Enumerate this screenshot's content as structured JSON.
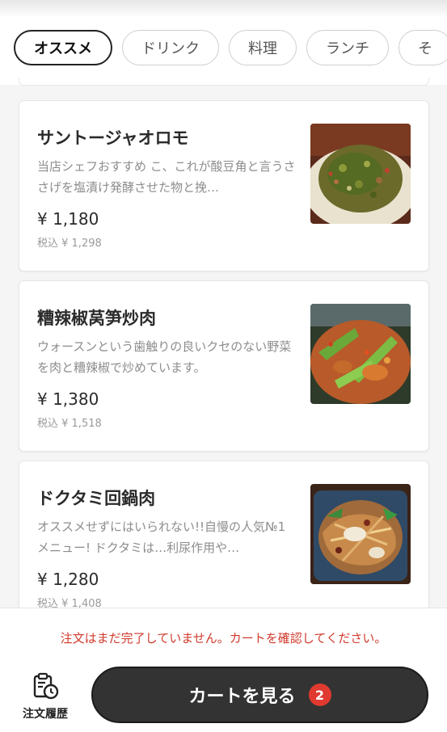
{
  "tabs": [
    {
      "label": "オススメ",
      "active": true
    },
    {
      "label": "ドリンク",
      "active": false
    },
    {
      "label": "料理",
      "active": false
    },
    {
      "label": "ランチ",
      "active": false
    },
    {
      "label": "そ",
      "active": false
    }
  ],
  "menu_items": [
    {
      "name": "サントージャオロモ",
      "description": "当店シェフおすすめ こ、これが酸豆角と言うささげを塩漬け発酵させた物と挽…",
      "price": "¥ 1,180",
      "tax_price": "税込 ¥ 1,298"
    },
    {
      "name": "糟辣椒莴笋炒肉",
      "description": "ウォースンという歯触りの良いクセのない野菜を肉と糟辣椒で炒めています。",
      "price": "¥ 1,380",
      "tax_price": "税込 ¥ 1,518"
    },
    {
      "name": "ドクタミ回鍋肉",
      "description": "オススメせずにはいられない!!自慢の人気№1メニュー! ドクタミは…利尿作用や…",
      "price": "¥ 1,280",
      "tax_price": "税込 ¥ 1,408"
    }
  ],
  "footer": {
    "notice": "注文はまだ完了していません。カートを確認してください。",
    "order_history_label": "注文履歴",
    "order_history_icon": "clipboard-clock-icon",
    "cart_button_label": "カートを見る",
    "cart_count": "2"
  },
  "colors": {
    "notice": "#d03a2c",
    "badge": "#e03a30",
    "cart_button": "#333333"
  }
}
